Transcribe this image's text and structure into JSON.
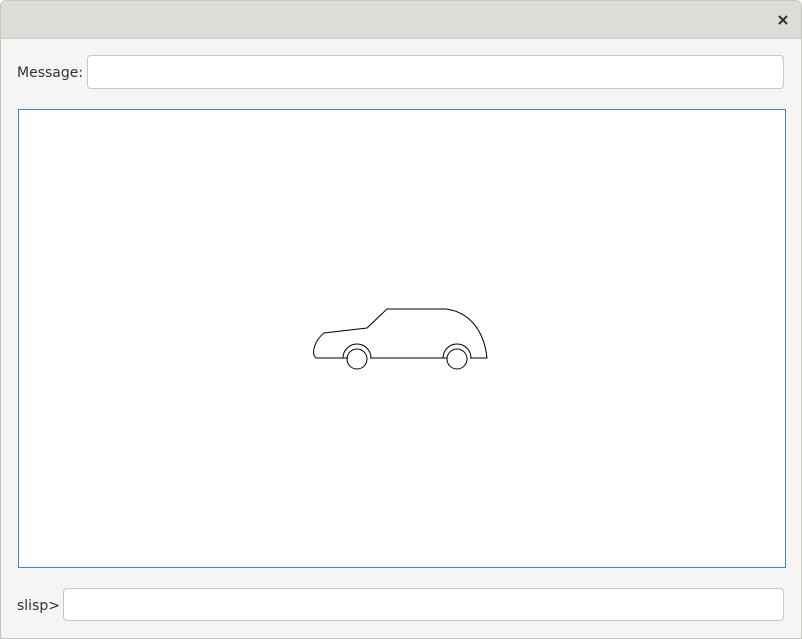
{
  "window": {
    "title": "",
    "close_icon": "close-icon"
  },
  "message": {
    "label": "Message:",
    "value": "",
    "placeholder": ""
  },
  "canvas": {
    "drawing": "car-outline",
    "colors": {
      "border": "#3584e4",
      "stroke": "#000000",
      "background": "#ffffff"
    }
  },
  "repl": {
    "prompt": "slisp>",
    "value": "",
    "placeholder": ""
  }
}
